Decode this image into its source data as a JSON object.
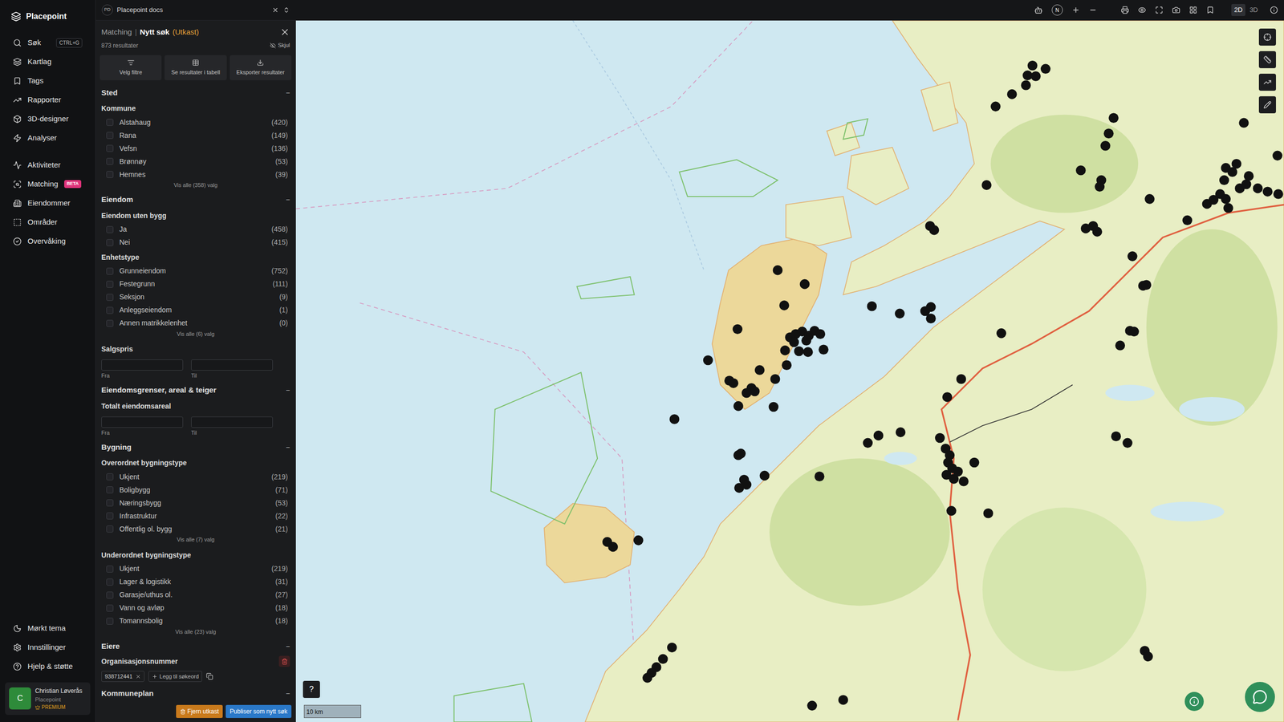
{
  "app": {
    "name": "Placepoint"
  },
  "nav": {
    "items": [
      {
        "label": "Søk",
        "shortcut": "CTRL+G",
        "selected": false
      },
      {
        "label": "Kartlag",
        "selected": false
      },
      {
        "label": "Tags",
        "selected": false
      },
      {
        "label": "Rapporter",
        "selected": false
      },
      {
        "label": "3D-designer",
        "selected": false
      },
      {
        "label": "Analyser",
        "selected": false
      }
    ],
    "items2": [
      {
        "label": "Aktiviteter",
        "selected": false
      },
      {
        "label": "Matching",
        "badge": "BETA",
        "selected": false
      },
      {
        "label": "Eiendommer",
        "selected": false
      },
      {
        "label": "Områder",
        "selected": false
      },
      {
        "label": "Overvåking",
        "selected": false
      }
    ],
    "bottom": [
      {
        "label": "Mørkt tema"
      },
      {
        "label": "Innstillinger"
      },
      {
        "label": "Hjelp & støtte"
      }
    ],
    "user": {
      "initial": "C",
      "name": "Christian Løverås",
      "org": "Placepoint",
      "plan": "PREMIUM"
    }
  },
  "topbar": {
    "badge": "PD",
    "workspace": "Placepoint docs",
    "compass": "N",
    "view_modes": [
      {
        "label": "2D",
        "selected": true
      },
      {
        "label": "3D",
        "selected": false
      }
    ]
  },
  "panel": {
    "breadcrumb": "Matching",
    "separator": "|",
    "title": "Nytt søk",
    "status": "(Utkast)",
    "result_count": "873 resultater",
    "hide": "Skjul",
    "actions": [
      "Velg filtre",
      "Se resultater i tabell",
      "Eksporter resultater"
    ],
    "sections": [
      {
        "title": "Sted",
        "toggle": "−",
        "expanded": true,
        "groups": [
          {
            "kind": "checklist",
            "label": "Kommune",
            "options": [
              {
                "label": "Alstahaug",
                "count": "(420)",
                "checked": false
              },
              {
                "label": "Rana",
                "count": "(149)",
                "checked": false
              },
              {
                "label": "Vefsn",
                "count": "(136)",
                "checked": false
              },
              {
                "label": "Brønnøy",
                "count": "(53)",
                "checked": false
              },
              {
                "label": "Hemnes",
                "count": "(39)",
                "checked": false
              }
            ],
            "more": "Vis alle (358) valg"
          }
        ]
      },
      {
        "title": "Eiendom",
        "toggle": "−",
        "expanded": true,
        "groups": [
          {
            "kind": "checklist",
            "label": "Eiendom uten bygg",
            "options": [
              {
                "label": "Ja",
                "count": "(458)",
                "checked": false
              },
              {
                "label": "Nei",
                "count": "(415)",
                "checked": false
              }
            ]
          },
          {
            "kind": "checklist",
            "label": "Enhetstype",
            "options": [
              {
                "label": "Grunneiendom",
                "count": "(752)",
                "checked": false
              },
              {
                "label": "Festegrunn",
                "count": "(111)",
                "checked": false
              },
              {
                "label": "Seksjon",
                "count": "(9)",
                "checked": false
              },
              {
                "label": "Anleggseiendom",
                "count": "(1)",
                "checked": false
              },
              {
                "label": "Annen matrikkelenhet",
                "count": "(0)",
                "checked": false
              }
            ],
            "more": "Vis alle (6) valg"
          },
          {
            "kind": "range",
            "label": "Salgspris",
            "from": "Fra",
            "to": "Til"
          }
        ]
      },
      {
        "title": "Eiendomsgrenser, areal & teiger",
        "toggle": "−",
        "expanded": true,
        "groups": [
          {
            "kind": "range",
            "label": "Totalt eiendomsareal",
            "from": "Fra",
            "to": "Til"
          }
        ]
      },
      {
        "title": "Bygning",
        "toggle": "−",
        "expanded": true,
        "groups": [
          {
            "kind": "checklist",
            "label": "Overordnet bygningstype",
            "options": [
              {
                "label": "Ukjent",
                "count": "(219)",
                "checked": false
              },
              {
                "label": "Boligbygg",
                "count": "(71)",
                "checked": false
              },
              {
                "label": "Næringsbygg",
                "count": "(53)",
                "checked": false
              },
              {
                "label": "Infrastruktur",
                "count": "(22)",
                "checked": false
              },
              {
                "label": "Offentlig ol. bygg",
                "count": "(21)",
                "checked": false
              }
            ],
            "more": "Vis alle (7) valg"
          },
          {
            "kind": "checklist",
            "label": "Underordnet bygningstype",
            "options": [
              {
                "label": "Ukjent",
                "count": "(219)",
                "checked": false
              },
              {
                "label": "Lager & logistikk",
                "count": "(31)",
                "checked": false
              },
              {
                "label": "Garasje/uthus ol.",
                "count": "(27)",
                "checked": false
              },
              {
                "label": "Vann og avløp",
                "count": "(18)",
                "checked": false
              },
              {
                "label": "Tomannsbolig",
                "count": "(18)",
                "checked": false
              }
            ],
            "more": "Vis alle (23) valg"
          }
        ]
      },
      {
        "title": "Eiere",
        "toggle": "−",
        "expanded": true,
        "groups": [
          {
            "kind": "tags",
            "label": "Organisasjonsnummer",
            "tags": [
              "938712441"
            ],
            "add": "Legg til søkeord"
          }
        ]
      },
      {
        "title": "Kommuneplan",
        "toggle": "−",
        "expanded": true,
        "groups": []
      }
    ],
    "footer": {
      "discard": "Fjern utkast",
      "publish": "Publiser som nytt søk"
    }
  },
  "map": {
    "help": "?",
    "scale": "10 km"
  }
}
